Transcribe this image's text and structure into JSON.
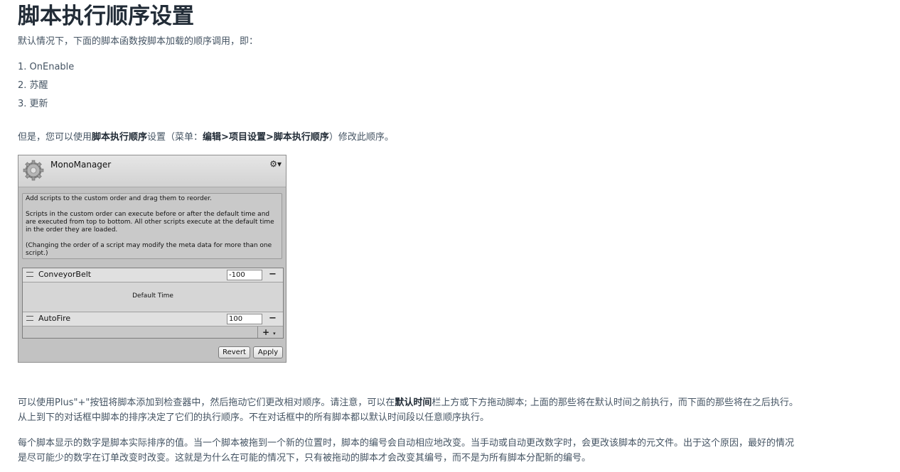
{
  "page": {
    "title": "脚本执行顺序设置",
    "intro": "默认情况下，下面的脚本函数按脚本加载的顺序调用，即：",
    "steps": [
      "1. OnEnable",
      "2. 苏醒",
      "3. 更新"
    ],
    "p1": {
      "a": "但是，您可以使用",
      "b1": "脚本执行顺序",
      "c": "设置（菜单：",
      "b2": "编辑>项目设置>脚本执行顺序",
      "d": "）修改此顺序。"
    },
    "p2": {
      "a": "可以使用Plus\"+\"按钮将脚本添加到检查器中，然后拖动它们更改相对顺序。请注意，可以在",
      "b": "默认时间",
      "c": "栏上方或下方拖动脚本; 上面的那些将在默认时间之前执行，而下面的那些将在之后执行。从上到下的对话框中脚本的排序决定了它们的执行顺序。不在对话框中的所有脚本都以默认时间段以任意顺序执行。"
    },
    "p3": "每个脚本显示的数字是脚本实际排序的值。当一个脚本被拖到一个新的位置时，脚本的编号会自动相应地改变。当手动或自动更改数字时，会更改该脚本的元文件。出于这个原因，最好的情况是尽可能少的数字在订单改变时改变。这就是为什么在可能的情况下，只有被拖动的脚本才会改变其编号，而不是为所有脚本分配新的编号。"
  },
  "inspector": {
    "title": "MonoManager",
    "help": [
      "Add scripts to the custom order and drag them to reorder.",
      "Scripts in the custom order can execute before or after the default time and are executed from top to bottom. All other scripts execute at the default time in the order they are loaded.",
      "(Changing the order of a script may modify the meta data for more than one script.)"
    ],
    "rows": [
      {
        "name": "ConveyorBelt",
        "order": "-100"
      },
      {
        "name": "AutoFire",
        "order": "100"
      }
    ],
    "default_time": "Default Time",
    "plus": "+",
    "revert": "Revert",
    "apply": "Apply",
    "icons": {
      "header": "gear-icon",
      "settings": "gear-menu-icon"
    }
  }
}
